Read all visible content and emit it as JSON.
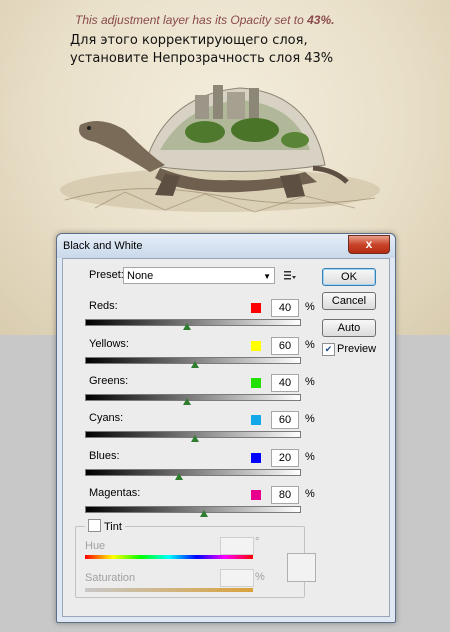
{
  "caption": {
    "english_prefix": "This adjustment layer has its Opacity set to ",
    "english_value": "43%.",
    "russian": "Для этого корректирующего слоя, установите Непрозрачность слоя 43%"
  },
  "dialog": {
    "title": "Black and White",
    "close_glyph": "x",
    "preset": {
      "label": "Preset:",
      "value": "None"
    },
    "buttons": {
      "ok": "OK",
      "cancel": "Cancel",
      "auto": "Auto"
    },
    "preview": {
      "label": "Preview",
      "checked": true
    },
    "percent_symbol": "%",
    "sliders": [
      {
        "name": "Reds",
        "label": "Reds:",
        "value": "40",
        "color": "#ff0000"
      },
      {
        "name": "Yellows",
        "label": "Yellows:",
        "value": "60",
        "color": "#ffff00"
      },
      {
        "name": "Greens",
        "label": "Greens:",
        "value": "40",
        "color": "#22e000"
      },
      {
        "name": "Cyans",
        "label": "Cyans:",
        "value": "60",
        "color": "#14a8e8"
      },
      {
        "name": "Blues",
        "label": "Blues:",
        "value": "20",
        "color": "#0000ff"
      },
      {
        "name": "Magentas",
        "label": "Magentas:",
        "value": "80",
        "color": "#e8008c"
      }
    ],
    "tint": {
      "label": "Tint",
      "checked": false,
      "hue_label": "Hue",
      "degree_symbol": "°",
      "saturation_label": "Saturation",
      "sat_percent": "%"
    }
  }
}
